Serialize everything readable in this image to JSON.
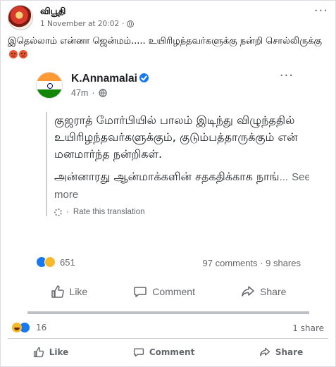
{
  "post": {
    "author": "விபூதி",
    "timestamp": "1 November at 20:02",
    "caption": "இதெல்லாம் என்னா ஜென்மம்..... உயிரிழந்தவர்களுக்கு நன்றி சொல்லிருக்கு",
    "reactions_count": "16",
    "shares": "1 share",
    "actions": {
      "like": "Like",
      "comment": "Comment",
      "share": "Share"
    }
  },
  "shared_image": {
    "name": "K.Annamalai",
    "time": "47m",
    "text_line1": "குஜராத் மோர்பியில் பாலம் இடிந்து விழுந்ததில் உயிரிழந்தவர்களுக்கும், குடும்பத்தாருக்கும் என் மனமார்ந்த நன்றிகள்.",
    "text_line2": "அன்னாரது ஆன்மாக்களின் சதகதிக்காக நாங்",
    "ellipsis": "...",
    "see_more": "See more",
    "rate_translation": "Rate this translation",
    "reactions_count": "651",
    "comments": "97 comments",
    "shares": "9 shares",
    "actions": {
      "like": "Like",
      "comment": "Comment",
      "share": "Share"
    }
  },
  "colors": {
    "brand_blue": "#1877f2",
    "muted_text": "#65676b"
  }
}
